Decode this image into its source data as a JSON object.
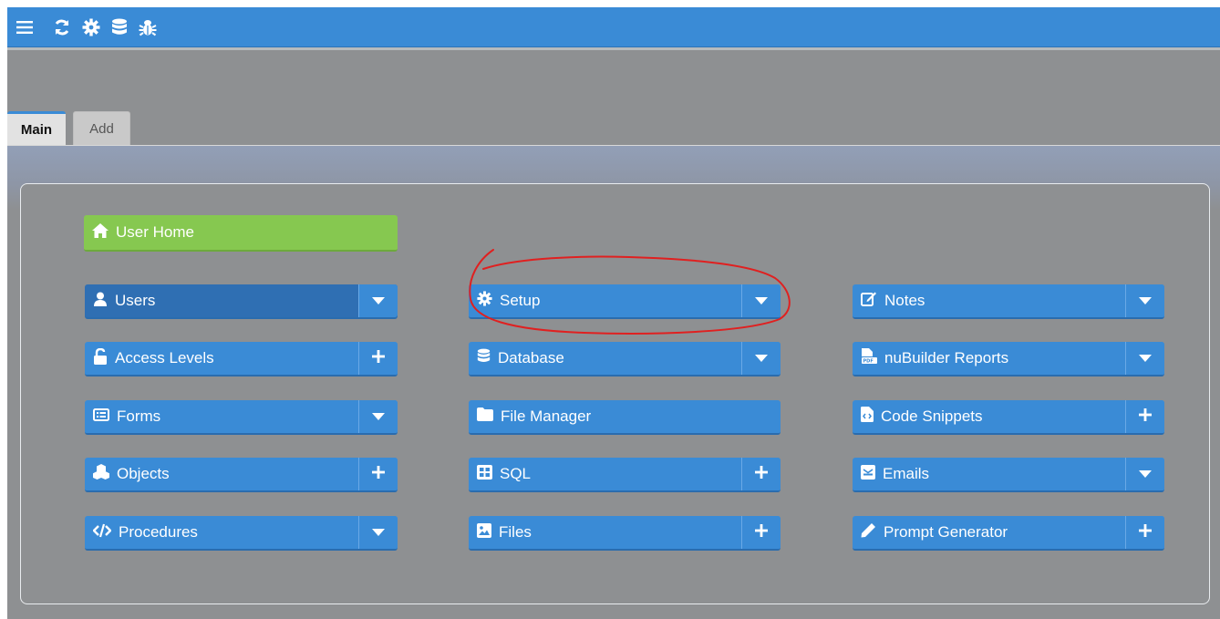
{
  "tabs": [
    {
      "label": "Main"
    },
    {
      "label": "Add"
    }
  ],
  "toolbar_icons": [
    "menu-icon",
    "refresh-icon",
    "gear-icon",
    "database-icon",
    "bug-icon"
  ],
  "home": {
    "label": "User Home",
    "icon": "home-icon"
  },
  "columns": {
    "left": [
      {
        "label": "Users",
        "icon": "user-icon",
        "action": "dropdown"
      },
      {
        "label": "Access Levels",
        "icon": "unlock-icon",
        "action": "add"
      },
      {
        "label": "Forms",
        "icon": "form-icon",
        "action": "dropdown"
      },
      {
        "label": "Objects",
        "icon": "cubes-icon",
        "action": "add"
      },
      {
        "label": "Procedures",
        "icon": "code-icon",
        "action": "dropdown"
      }
    ],
    "middle": [
      {
        "label": "Setup",
        "icon": "gear-icon",
        "action": "dropdown"
      },
      {
        "label": "Database",
        "icon": "database-icon",
        "action": "dropdown"
      },
      {
        "label": "File Manager",
        "icon": "folder-icon",
        "action": "none"
      },
      {
        "label": "SQL",
        "icon": "table-icon",
        "action": "add"
      },
      {
        "label": "Files",
        "icon": "image-icon",
        "action": "add"
      }
    ],
    "right": [
      {
        "label": "Notes",
        "icon": "edit-icon",
        "action": "dropdown"
      },
      {
        "label": "nuBuilder Reports",
        "icon": "pdf-icon",
        "action": "dropdown"
      },
      {
        "label": "Code Snippets",
        "icon": "code-file-icon",
        "action": "add"
      },
      {
        "label": "Emails",
        "icon": "envelope-icon",
        "action": "dropdown"
      },
      {
        "label": "Prompt Generator",
        "icon": "pencil-icon",
        "action": "add"
      }
    ]
  },
  "colors": {
    "accent": "#3a8bd6",
    "selected": "#2f6fb3",
    "home": "#86c850",
    "annotation": "#e02020"
  }
}
